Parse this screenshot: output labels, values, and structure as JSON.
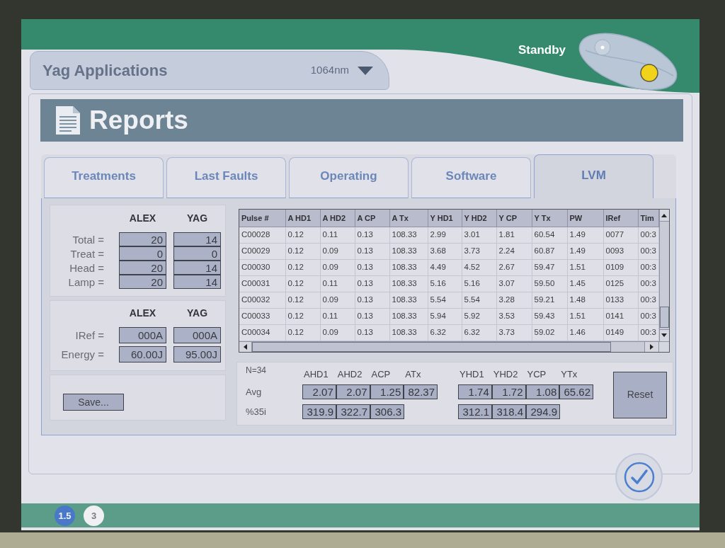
{
  "header": {
    "application_selector": {
      "label": "Yag Applications",
      "value": "1064nm",
      "disabled": true
    },
    "status": "Standby"
  },
  "page_title": "Reports",
  "tabs": [
    {
      "label": "Treatments",
      "selected": false
    },
    {
      "label": "Last Faults",
      "selected": false
    },
    {
      "label": "Operating",
      "selected": false
    },
    {
      "label": "Software",
      "selected": false
    },
    {
      "label": "LVM",
      "selected": true
    }
  ],
  "counters": {
    "columns": [
      "ALEX",
      "YAG"
    ],
    "rows": [
      {
        "label": "Total =",
        "values": [
          "20",
          "14"
        ]
      },
      {
        "label": "Treat =",
        "values": [
          "0",
          "0"
        ]
      },
      {
        "label": "Head =",
        "values": [
          "20",
          "14"
        ]
      },
      {
        "label": "Lamp =",
        "values": [
          "20",
          "14"
        ]
      }
    ]
  },
  "references": {
    "columns": [
      "ALEX",
      "YAG"
    ],
    "rows": [
      {
        "label": "IRef =",
        "values": [
          "000A",
          "000A"
        ]
      },
      {
        "label": "Energy =",
        "values": [
          "60.00J",
          "95.00J"
        ]
      }
    ]
  },
  "save_button": {
    "label": "Save..."
  },
  "table": {
    "columns": [
      "Pulse #",
      "A HD1",
      "A HD2",
      "A CP",
      "A Tx",
      "Y HD1",
      "Y HD2",
      "Y CP",
      "Y Tx",
      "PW",
      "IRef",
      "Tim"
    ],
    "rows": [
      [
        "C00028",
        "0.12",
        "0.11",
        "0.13",
        "108.33",
        "2.99",
        "3.01",
        "1.81",
        "60.54",
        "1.49",
        "0077",
        "00:3"
      ],
      [
        "C00029",
        "0.12",
        "0.09",
        "0.13",
        "108.33",
        "3.68",
        "3.73",
        "2.24",
        "60.87",
        "1.49",
        "0093",
        "00:3"
      ],
      [
        "C00030",
        "0.12",
        "0.09",
        "0.13",
        "108.33",
        "4.49",
        "4.52",
        "2.67",
        "59.47",
        "1.51",
        "0109",
        "00:3"
      ],
      [
        "C00031",
        "0.12",
        "0.11",
        "0.13",
        "108.33",
        "5.16",
        "5.16",
        "3.07",
        "59.50",
        "1.45",
        "0125",
        "00:3"
      ],
      [
        "C00032",
        "0.12",
        "0.09",
        "0.13",
        "108.33",
        "5.54",
        "5.54",
        "3.28",
        "59.21",
        "1.48",
        "0133",
        "00:3"
      ],
      [
        "C00033",
        "0.12",
        "0.11",
        "0.13",
        "108.33",
        "5.94",
        "5.92",
        "3.53",
        "59.43",
        "1.51",
        "0141",
        "00:3"
      ],
      [
        "C00034",
        "0.12",
        "0.09",
        "0.13",
        "108.33",
        "6.32",
        "6.32",
        "3.73",
        "59.02",
        "1.46",
        "0149",
        "00:3"
      ]
    ]
  },
  "statistics": {
    "count": "N=34",
    "row_labels": [
      "Avg",
      "%35i"
    ],
    "groups": [
      {
        "columns": [
          "AHD1",
          "AHD2",
          "ACP",
          "ATx"
        ],
        "rows": [
          [
            "2.07",
            "2.07",
            "1.25",
            "82.37"
          ],
          [
            "319.9",
            "322.7",
            "306.3"
          ]
        ]
      },
      {
        "columns": [
          "YHD1",
          "YHD2",
          "YCP",
          "YTx"
        ],
        "rows": [
          [
            "1.74",
            "1.72",
            "1.08",
            "65.62"
          ],
          [
            "312.1",
            "318.4",
            "294.9"
          ]
        ]
      }
    ]
  },
  "reset_button": {
    "label": "Reset"
  },
  "footer": {
    "indicators": [
      {
        "label": "1.5",
        "color": "#4a78c9"
      },
      {
        "label": "3",
        "color": "#f0f0f2"
      }
    ]
  }
}
